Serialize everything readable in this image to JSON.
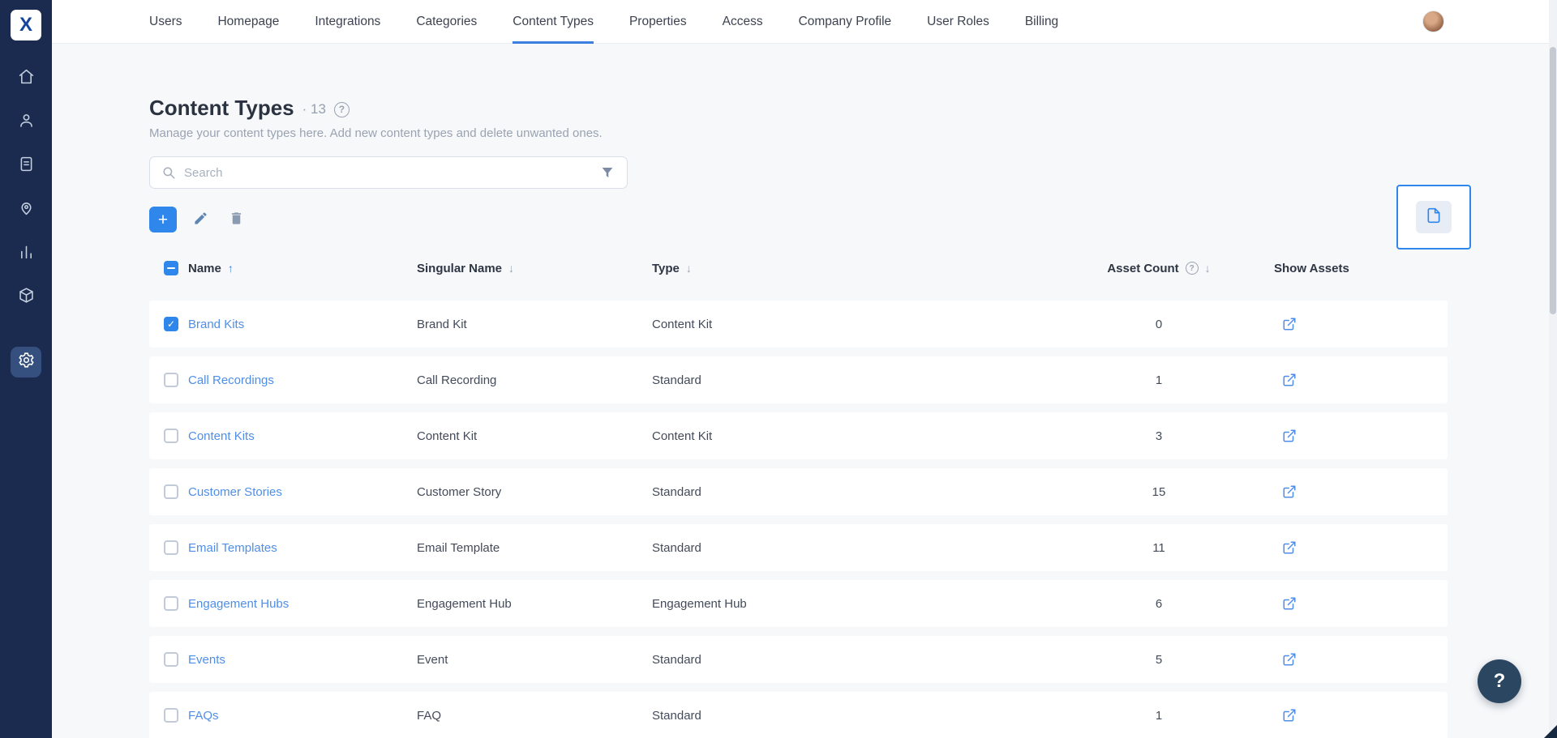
{
  "colors": {
    "accent": "#2f86eb",
    "link": "#4f8ee8",
    "sidebar": "#1b2b50",
    "bg": "#f7f8fa"
  },
  "sidebar": {
    "logo_text": "X",
    "items": [
      {
        "icon": "home"
      },
      {
        "icon": "users"
      },
      {
        "icon": "documents"
      },
      {
        "icon": "pin"
      },
      {
        "icon": "analytics"
      },
      {
        "icon": "apps"
      },
      {
        "icon": "settings",
        "active": true
      }
    ]
  },
  "topnav": {
    "items": [
      {
        "label": "Users"
      },
      {
        "label": "Homepage"
      },
      {
        "label": "Integrations"
      },
      {
        "label": "Categories"
      },
      {
        "label": "Content Types",
        "active": true
      },
      {
        "label": "Properties"
      },
      {
        "label": "Access"
      },
      {
        "label": "Company Profile"
      },
      {
        "label": "User Roles"
      },
      {
        "label": "Billing"
      }
    ]
  },
  "page": {
    "title": "Content Types",
    "count": "· 13",
    "help_icon": "?",
    "subtitle": "Manage your content types here. Add new content types and delete unwanted ones.",
    "search_placeholder": "Search"
  },
  "toolbar": {
    "add_label": "+"
  },
  "table": {
    "columns": [
      "Name",
      "Singular Name",
      "Type",
      "Asset Count",
      "Show Assets"
    ],
    "asset_count_help": "?",
    "rows": [
      {
        "name": "Brand Kits",
        "singular_name": "Brand Kit",
        "type": "Content Kit",
        "asset_count": "0",
        "checked": true
      },
      {
        "name": "Call Recordings",
        "singular_name": "Call Recording",
        "type": "Standard",
        "asset_count": "1",
        "checked": false
      },
      {
        "name": "Content Kits",
        "singular_name": "Content Kit",
        "type": "Content Kit",
        "asset_count": "3",
        "checked": false
      },
      {
        "name": "Customer Stories",
        "singular_name": "Customer Story",
        "type": "Standard",
        "asset_count": "15",
        "checked": false
      },
      {
        "name": "Email Templates",
        "singular_name": "Email Template",
        "type": "Standard",
        "asset_count": "11",
        "checked": false
      },
      {
        "name": "Engagement Hubs",
        "singular_name": "Engagement Hub",
        "type": "Engagement Hub",
        "asset_count": "6",
        "checked": false
      },
      {
        "name": "Events",
        "singular_name": "Event",
        "type": "Standard",
        "asset_count": "5",
        "checked": false
      },
      {
        "name": "FAQs",
        "singular_name": "FAQ",
        "type": "Standard",
        "asset_count": "1",
        "checked": false
      }
    ]
  },
  "help": {
    "fab_label": "?"
  }
}
